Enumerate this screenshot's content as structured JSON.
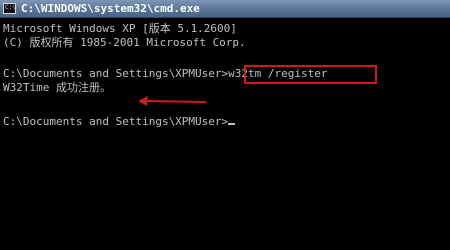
{
  "window": {
    "title": "C:\\WINDOWS\\system32\\cmd.exe",
    "icon": "cmd-icon",
    "icon_glyph": "C:\\"
  },
  "console": {
    "line1": "Microsoft Windows XP [版本 5.1.2600]",
    "line2": "(C) 版权所有 1985-2001 Microsoft Corp.",
    "prompt1": "C:\\Documents and Settings\\XPMUser>",
    "command": "w32tm /register",
    "result": "W32Time 成功注册。",
    "prompt2": "C:\\Documents and Settings\\XPMUser>"
  },
  "annotation": {
    "highlight_color": "#d01a1a"
  }
}
